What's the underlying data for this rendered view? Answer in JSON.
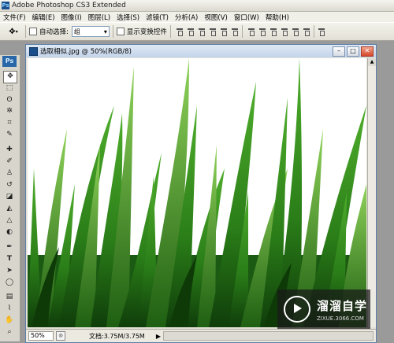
{
  "app": {
    "title": "Adobe Photoshop CS3 Extended",
    "logo_text": "Ps"
  },
  "menu": [
    "文件(F)",
    "编辑(E)",
    "图像(I)",
    "图层(L)",
    "选择(S)",
    "滤镜(T)",
    "分析(A)",
    "视图(V)",
    "窗口(W)",
    "帮助(H)"
  ],
  "options": {
    "auto_select_label": "自动选择:",
    "auto_select_value": "组",
    "show_transform_label": "显示变换控件"
  },
  "document": {
    "title": "选取相似.jpg @ 50%(RGB/8)",
    "zoom": "50%",
    "doc_size": "文档:3.75M/3.75M"
  },
  "watermark": {
    "brand": "溜溜自学",
    "url": "ZIXUE.3066.COM"
  },
  "icons": {
    "move_tool": "move-icon",
    "marquee_tool": "marquee-icon",
    "lasso_tool": "lasso-icon",
    "magic_wand_tool": "magic-wand-icon",
    "crop_tool": "crop-icon",
    "slice_tool": "slice-icon",
    "healing_tool": "healing-brush-icon",
    "brush_tool": "brush-icon",
    "stamp_tool": "clone-stamp-icon",
    "history_brush_tool": "history-brush-icon",
    "eraser_tool": "eraser-icon",
    "gradient_tool": "gradient-icon",
    "blur_tool": "blur-icon",
    "dodge_tool": "dodge-icon",
    "pen_tool": "pen-icon",
    "type_tool": "type-icon",
    "path_select_tool": "path-select-icon",
    "shape_tool": "shape-icon",
    "notes_tool": "notes-icon",
    "eyedropper_tool": "eyedropper-icon",
    "hand_tool": "hand-icon",
    "zoom_tool": "zoom-icon"
  }
}
